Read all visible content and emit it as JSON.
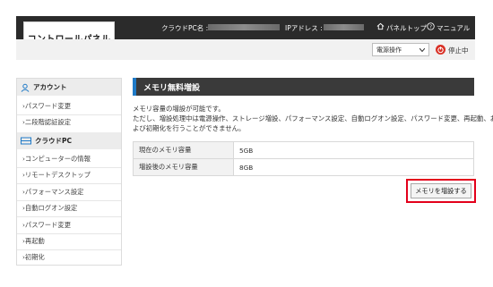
{
  "header": {
    "logo": "コントロールパネル",
    "pc_name_label": "クラウドPC名 :",
    "ip_label": "IPアドレス :",
    "panel_top": "パネルトップ",
    "manual": "マニュアル"
  },
  "toolbar": {
    "power_select": "電源操作",
    "status": "停止中"
  },
  "sidebar": {
    "account_title": "アカウント",
    "account_items": [
      "パスワード変更",
      "二段階認証設定"
    ],
    "cloudpc_title": "クラウドPC",
    "cloudpc_items": [
      "コンピューターの情報",
      "リモートデスクトップ",
      "パフォーマンス設定",
      "自動ログオン設定",
      "パスワード変更",
      "再起動",
      "初期化"
    ]
  },
  "main": {
    "title": "メモリ無料増設",
    "desc_line1": "メモリ容量の増設が可能です。",
    "desc_line2": "ただし、増設処理中は電源操作、ストレージ増設、パフォーマンス設定、自動ログオン設定、パスワード変更、再起動、お",
    "desc_line3": "よび初期化を行うことができません。",
    "rows": [
      {
        "label": "現在のメモリ容量",
        "value": "5GB"
      },
      {
        "label": "増設後のメモリ容量",
        "value": "8GB"
      }
    ],
    "button": "メモリを増設する"
  },
  "colors": {
    "header": "#2b2b2b",
    "accent": "#1f7ac7",
    "stop": "#d93025",
    "highlight": "#e3001b"
  }
}
